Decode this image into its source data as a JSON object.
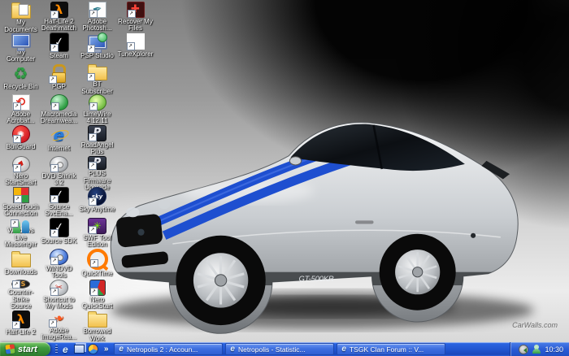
{
  "desktop": {
    "watermark": "CarWalls.com",
    "wallpaper_car_text": "GT-500KR",
    "icons": [
      {
        "name": "my-documents",
        "type": "folder-docs",
        "label": "My Documents",
        "col": 0,
        "row": 0,
        "shortcut": false
      },
      {
        "name": "half-life-2-deathmatch",
        "type": "hl2",
        "label": "Half-Life 2 Deathmatch",
        "col": 1,
        "row": 0,
        "shortcut": true
      },
      {
        "name": "adobe-photoshop",
        "type": "ps",
        "label": "Adobe Photosh...",
        "col": 2,
        "row": 0,
        "shortcut": true
      },
      {
        "name": "recover-my-files",
        "type": "recover",
        "label": "Recover My Files",
        "col": 3,
        "row": 0,
        "shortcut": true
      },
      {
        "name": "my-computer",
        "type": "pc",
        "label": "My Computer",
        "col": 0,
        "row": 1,
        "shortcut": false
      },
      {
        "name": "steam",
        "type": "steam",
        "label": "Steam",
        "col": 1,
        "row": 1,
        "shortcut": true
      },
      {
        "name": "psp-studio",
        "type": "pspstudio",
        "label": "PSP Studio",
        "col": 2,
        "row": 1,
        "shortcut": true
      },
      {
        "name": "tunexplorer",
        "type": "tunex",
        "label": "TuneXplorer",
        "col": 3,
        "row": 1,
        "shortcut": true
      },
      {
        "name": "recycle-bin",
        "type": "recycle",
        "label": "Recycle Bin",
        "col": 0,
        "row": 2,
        "shortcut": false
      },
      {
        "name": "pgp",
        "type": "lock",
        "label": "PGP",
        "col": 1,
        "row": 2,
        "shortcut": true
      },
      {
        "name": "bt-subscriber",
        "type": "folder",
        "label": "BT Subscriber",
        "col": 2,
        "row": 2,
        "shortcut": true
      },
      {
        "name": "adobe-acrobat",
        "type": "acrobat",
        "label": "Adobe Acrobat...",
        "col": 0,
        "row": 3,
        "shortcut": true
      },
      {
        "name": "macromedia-dreamweaver",
        "type": "dw",
        "label": "Macromedia Dreamwea...",
        "col": 1,
        "row": 3,
        "shortcut": true
      },
      {
        "name": "limewire",
        "type": "lime",
        "label": "LimeWire 4.12.11",
        "col": 2,
        "row": 3,
        "shortcut": true
      },
      {
        "name": "bullguard",
        "type": "bullguard",
        "label": "BullGuard",
        "col": 0,
        "row": 4,
        "shortcut": true
      },
      {
        "name": "internet",
        "type": "ie",
        "label": "Internet",
        "col": 1,
        "row": 4,
        "shortcut": false
      },
      {
        "name": "roadangel-plus",
        "type": "p-dark",
        "label": "RoadAngel Plus",
        "col": 2,
        "row": 4,
        "shortcut": true
      },
      {
        "name": "nero-startsmart",
        "type": "nero",
        "label": "Nero StartSmart",
        "col": 0,
        "row": 5,
        "shortcut": true
      },
      {
        "name": "dvd-shrink",
        "type": "dvdshrink",
        "label": "DVD Shrink 3.2",
        "col": 1,
        "row": 5,
        "shortcut": true
      },
      {
        "name": "plus-firmware-upgrade",
        "type": "p-dark",
        "label": "PLUS Firmware Upgrade",
        "col": 2,
        "row": 5,
        "shortcut": true
      },
      {
        "name": "speedtouch-connection",
        "type": "speedtouch",
        "label": "SpeedTouch Connection",
        "col": 0,
        "row": 6,
        "shortcut": true
      },
      {
        "name": "source-svcena",
        "type": "steam",
        "label": "Source SvcEna...",
        "col": 1,
        "row": 6,
        "shortcut": true
      },
      {
        "name": "sky-anytime",
        "type": "sky",
        "label": "Sky Anytime",
        "col": 2,
        "row": 6,
        "shortcut": true
      },
      {
        "name": "windows-live-messenger",
        "type": "msn",
        "label": "Windows Live Messenger",
        "col": 0,
        "row": 7,
        "shortcut": true
      },
      {
        "name": "source-sdk",
        "type": "steam",
        "label": "Source SDK",
        "col": 1,
        "row": 7,
        "shortcut": true
      },
      {
        "name": "swf-tool-edition",
        "type": "swf",
        "label": "SWF Tool Edition",
        "col": 2,
        "row": 7,
        "shortcut": true
      },
      {
        "name": "downloads",
        "type": "folder",
        "label": "Downloads",
        "col": 0,
        "row": 8,
        "shortcut": false
      },
      {
        "name": "windvd-tools",
        "type": "windvd",
        "label": "WINDVD Tools",
        "col": 1,
        "row": 8,
        "shortcut": true
      },
      {
        "name": "quicktime",
        "type": "qt",
        "label": "QuickTime",
        "col": 2,
        "row": 8,
        "shortcut": true
      },
      {
        "name": "counter-strike-source",
        "type": "css",
        "label": "Counter-Strike Source",
        "col": 0,
        "row": 9,
        "shortcut": true
      },
      {
        "name": "shortcut-to-my-mods",
        "type": "mods",
        "label": "Shortcut to My Mods",
        "col": 1,
        "row": 9,
        "shortcut": true
      },
      {
        "name": "nero-quickstart",
        "type": "cube",
        "label": "Nero QuickStart",
        "col": 2,
        "row": 9,
        "shortcut": true
      },
      {
        "name": "half-life-2",
        "type": "hl2",
        "label": "Half-Life 2",
        "col": 0,
        "row": 10,
        "shortcut": true
      },
      {
        "name": "adobe-imageready",
        "type": "imgready",
        "label": "Adobe ImageRea...",
        "col": 1,
        "row": 10,
        "shortcut": true
      },
      {
        "name": "borrowed-work",
        "type": "folder",
        "label": "Borrowed Work",
        "col": 2,
        "row": 10,
        "shortcut": false
      }
    ]
  },
  "taskbar": {
    "start_label": "start",
    "overflow_chevron": "»",
    "quick_launch": [
      {
        "name": "internet-explorer-quicklaunch"
      },
      {
        "name": "show-desktop-quicklaunch"
      },
      {
        "name": "media-player-quicklaunch"
      }
    ],
    "windows": [
      {
        "title": "Netropolis 2 : Accoun..."
      },
      {
        "title": "Netropolis - Statistic..."
      },
      {
        "title": "TSGK Clan Forum :: V..."
      }
    ],
    "tray": {
      "clock": "10:30"
    }
  },
  "colors": {
    "taskbar_blue": "#2054cf",
    "start_green": "#3f9b3f",
    "stripe_blue": "#1e4fd0",
    "label_text": "#ffffff"
  }
}
